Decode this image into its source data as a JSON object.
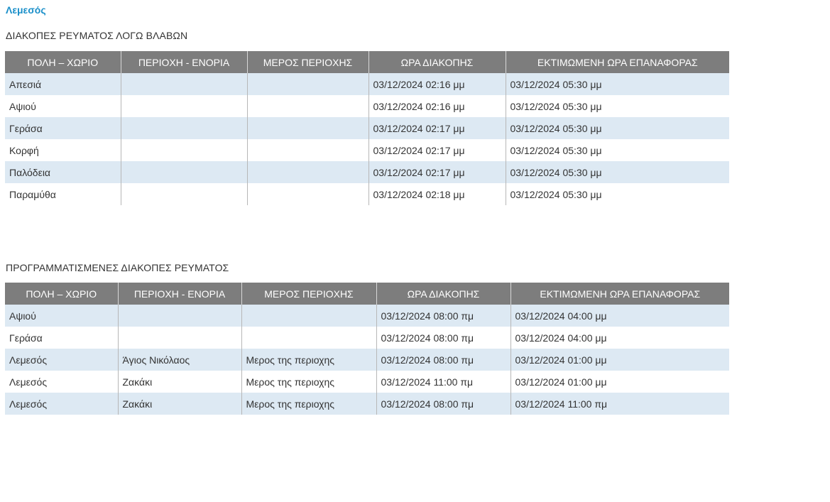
{
  "city_link": "Λεμεσός",
  "faults": {
    "title": "ΔΙΑΚΟΠΕΣ ΡΕΥΜΑΤΟΣ ΛΟΓΩ ΒΛΑΒΩΝ",
    "headers": [
      "ΠΟΛΗ – ΧΩΡΙΟ",
      "ΠΕΡΙΟΧΗ - ΕΝΟΡΙΑ",
      "ΜΕΡΟΣ ΠΕΡΙΟΧΗΣ",
      "ΩΡΑ ΔΙΑΚΟΠΗΣ",
      "ΕΚΤΙΜΩΜΕΝΗ ΩΡΑ ΕΠΑΝΑΦΟΡΑΣ"
    ],
    "rows": [
      [
        "Απεσιά",
        "",
        "",
        "03/12/2024 02:16 μμ",
        "03/12/2024 05:30 μμ"
      ],
      [
        "Αψιού",
        "",
        "",
        "03/12/2024 02:16 μμ",
        "03/12/2024 05:30 μμ"
      ],
      [
        "Γεράσα",
        "",
        "",
        "03/12/2024 02:17 μμ",
        "03/12/2024 05:30 μμ"
      ],
      [
        "Κορφή",
        "",
        "",
        "03/12/2024 02:17 μμ",
        "03/12/2024 05:30 μμ"
      ],
      [
        "Παλόδεια",
        "",
        "",
        "03/12/2024 02:17 μμ",
        "03/12/2024 05:30 μμ"
      ],
      [
        "Παραμύθα",
        "",
        "",
        "03/12/2024 02:18 μμ",
        "03/12/2024 05:30 μμ"
      ]
    ]
  },
  "planned": {
    "title": "ΠΡΟΓΡΑΜΜΑΤΙΣΜΕΝΕΣ ΔΙΑΚΟΠΕΣ ΡΕΥΜΑΤΟΣ",
    "headers": [
      "ΠΟΛΗ – ΧΩΡΙΟ",
      "ΠΕΡΙΟΧΗ - ΕΝΟΡΙΑ",
      "ΜΕΡΟΣ ΠΕΡΙΟΧΗΣ",
      "ΩΡΑ ΔΙΑΚΟΠΗΣ",
      "ΕΚΤΙΜΩΜΕΝΗ ΩΡΑ ΕΠΑΝΑΦΟΡΑΣ"
    ],
    "rows": [
      [
        "Αψιού",
        "",
        "",
        "03/12/2024 08:00 πμ",
        "03/12/2024 04:00 μμ"
      ],
      [
        "Γεράσα",
        "",
        "",
        "03/12/2024 08:00 πμ",
        "03/12/2024 04:00 μμ"
      ],
      [
        "Λεμεσός",
        "Άγιος Νικόλαος",
        "Μερος της περιοχης",
        "03/12/2024 08:00 πμ",
        "03/12/2024 01:00 μμ"
      ],
      [
        "Λεμεσός",
        "Ζακάκι",
        "Μερος της περιοχης",
        "03/12/2024 11:00 πμ",
        "03/12/2024 01:00 μμ"
      ],
      [
        "Λεμεσός",
        "Ζακάκι",
        "Μερος της περιοχης",
        "03/12/2024 08:00 πμ",
        "03/12/2024 11:00 πμ"
      ]
    ]
  }
}
